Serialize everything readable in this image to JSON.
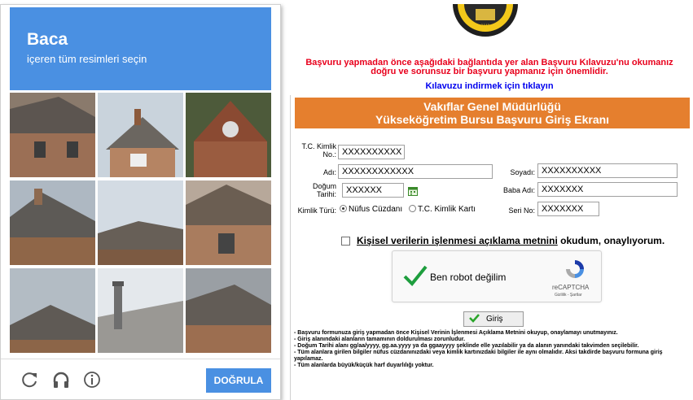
{
  "captcha": {
    "keyword": "Baca",
    "instruction": "içeren tüm resimleri seçin",
    "verify_label": "DOĞRULA",
    "icons": [
      "reload-icon",
      "headphones-icon",
      "info-icon"
    ],
    "accent": "#4a90e2"
  },
  "page": {
    "warning_line1": "Başvuru yapmadan önce aşağıdaki bağlantıda yer alan Başvuru Kılavuzu'nu okumanız",
    "warning_line2": "doğru ve sorunsuz bir başvuru yapmanız için önemlidir.",
    "guide_link": "Kılavuzu indirmek için tıklayın",
    "banner_line1": "Vakıflar Genel Müdürlüğü",
    "banner_line2": "Yükseköğretim Bursu Başvuru Giriş Ekranı",
    "banner_color": "#e57f2e",
    "warning_color": "#e8001c"
  },
  "form": {
    "tc_label_1": "T.C. Kimlik",
    "tc_label_2": "No.:",
    "tc_value": "XXXXXXXXXX",
    "ad_label": "Adı:",
    "ad_value": "XXXXXXXXXXXX",
    "soyad_label": "Soyadı:",
    "soyad_value": "XXXXXXXXXX",
    "dogum_label_1": "Doğum",
    "dogum_label_2": "Tarihi:",
    "dogum_value": "XXXXXX",
    "baba_label": "Baba Adı:",
    "baba_value": "XXXXXXX",
    "kimlik_label": "Kimlik Türü:",
    "radio_1": "Nüfus Cüzdanı",
    "radio_2": "T.C. Kimlik Kartı",
    "seri_label": "Seri No:",
    "seri_value": "XXXXXXX",
    "consent_link": "Kişisel verilerin işlenmesi açıklama metnini",
    "consent_rest": " okudum, onaylıyorum.",
    "robot_label": "Ben robot değilim",
    "recaptcha_name": "reCAPTCHA",
    "recaptcha_terms": "Gizlilik - Şartlar",
    "login_label": "Giriş"
  },
  "notes": [
    "- Başvuru formunuza giriş yapmadan önce Kişisel Verinin İşlenmesi Açıklama Metnini okuyup, onaylamayı unutmayınız.",
    "- Giriş alanındaki alanların tamamının doldurulması zorunludur.",
    "- Doğum Tarihi alanı gg/aa/yyyy, gg.aa.yyyy ya da ggaayyyy şeklinde elle yazılabilir ya da alanın yanındaki takvimden seçilebilir.",
    "- Tüm alanlara girilen bilgiler nüfus cüzdanınızdaki veya kimlik kartınızdaki bilgiler ile aynı olmalıdır. Aksi takdirde başvuru formuna giriş yapılamaz.",
    "- Tüm alanlarda büyük/küçük harf duyarlılığı yoktur."
  ]
}
